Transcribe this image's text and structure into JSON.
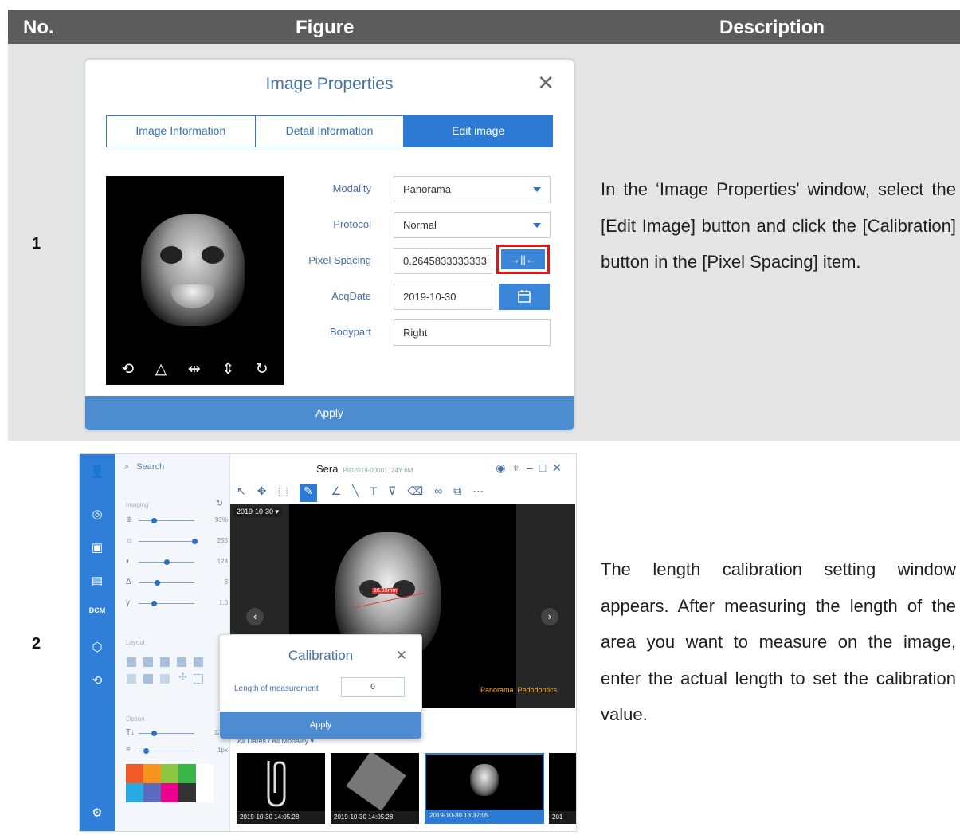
{
  "table": {
    "headers": [
      "No.",
      "Figure",
      "Description"
    ],
    "rows": [
      {
        "no": "1",
        "description": "In the ‘Image Properties' window, select the [Edit Image] button and click the [Calibration] button in the [Pixel Spacing] item."
      },
      {
        "no": "2",
        "description": "The length calibration setting window appears. After measuring the length of the area you want to measure on the image, enter the actual length to set the calibration value."
      }
    ]
  },
  "image_properties": {
    "title": "Image Properties",
    "tabs": [
      "Image Information",
      "Detail Information",
      "Edit image"
    ],
    "active_tab": "Edit image",
    "fields": {
      "modality": {
        "label": "Modality",
        "value": "Panorama"
      },
      "protocol": {
        "label": "Protocol",
        "value": "Normal"
      },
      "pixel_spacing": {
        "label": "Pixel Spacing",
        "value": "0.2645833333333"
      },
      "acq_date": {
        "label": "AcqDate",
        "value": "2019-10-30"
      },
      "bodypart": {
        "label": "Bodypart",
        "value": "Right"
      }
    },
    "apply_label": "Apply",
    "highlight_color": "#e01616",
    "accent_color": "#2e7bd6"
  },
  "viewer": {
    "search_placeholder": "Search",
    "title": "Sera",
    "subtitle": "PID2019-00001, 24Y 6M",
    "sections": {
      "imaging": "Imaging",
      "layout": "Layout",
      "option": "Option"
    },
    "sliders": [
      {
        "value": "93%",
        "level": 0.25
      },
      {
        "value": "255",
        "level": 1.0
      },
      {
        "value": "128",
        "level": 0.5
      },
      {
        "value": "3",
        "level": 0.3
      },
      {
        "value": "1.0",
        "level": 0.25
      }
    ],
    "option_sliders": [
      {
        "icon": "T↕",
        "value": "12px",
        "level": 0.25
      },
      {
        "icon": "≡",
        "value": "1px",
        "level": 0.1
      }
    ],
    "date_label": "2019-10-30",
    "tag_left": "Panorama",
    "tag_right": "Pedodontics",
    "measure_value": "16.83mm",
    "filter_label": "All Dates / All Modality",
    "thumbnails": [
      "2019-10-30  14:05:28",
      "2019-10-30  14:05:28",
      "2019-10-30  13:37:05",
      "201"
    ],
    "palette": [
      "#f05a28",
      "#f7941d",
      "#8dc63f",
      "#39b54a",
      "#ffffff",
      "#29abe2",
      "#5c6bc0",
      "#ec008c",
      "#333333",
      "#ffffff"
    ],
    "calibration": {
      "title": "Calibration",
      "field_label": "Length of measurement",
      "field_value": "0",
      "apply_label": "Apply"
    }
  }
}
